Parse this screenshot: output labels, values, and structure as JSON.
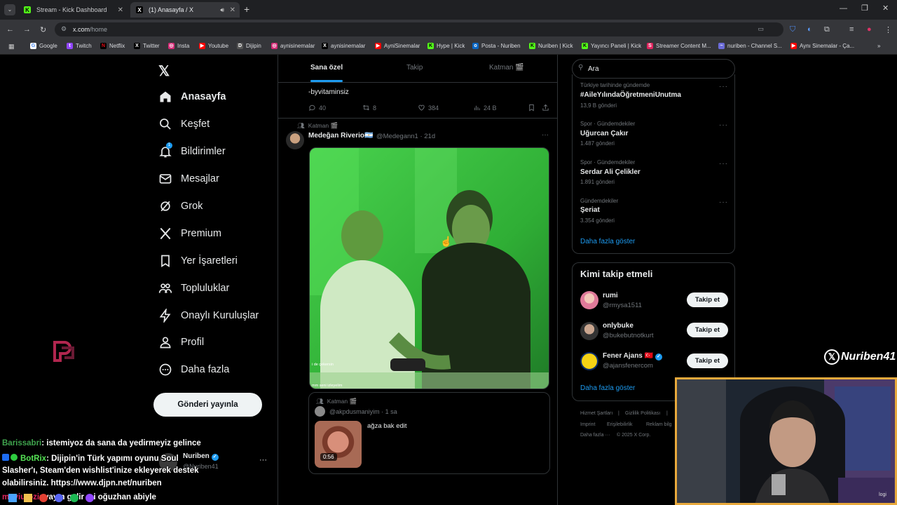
{
  "browser": {
    "tabs": [
      {
        "title": "Stream - Kick Dashboard",
        "active": false
      },
      {
        "title": "(1) Anasayfa / X",
        "active": true
      }
    ],
    "url_host": "x.com",
    "url_path": "/home",
    "bookmarks": [
      "Google",
      "Twitch",
      "Netflix",
      "Twitter",
      "Insta",
      "Youtube",
      "Dijipin",
      "aynisinemalar",
      "aynisinemalar",
      "AyniSinemalar",
      "Hype | Kick",
      "Posta - Nuriben",
      "Nuriben | Kick",
      "Yayıncı Paneli | Kick",
      "Streamer Content M...",
      "nuriben - Channel S...",
      "Aynı Sinemalar - Ça..."
    ]
  },
  "nav": {
    "items": [
      "Anasayfa",
      "Keşfet",
      "Bildirimler",
      "Mesajlar",
      "Grok",
      "Premium",
      "Yer İşaretleri",
      "Topluluklar",
      "Onaylı Kuruluşlar",
      "Profil",
      "Daha fazla"
    ],
    "notif_badge": "1",
    "post_button": "Gönderi yayınla",
    "account_name": "Nuriben",
    "account_handle": "@Nuriben41"
  },
  "timeline": {
    "tabs": [
      "Sana özel",
      "Takip",
      "Katman 🎬"
    ],
    "prev_tweet_text": "-byvitaminsiz",
    "prev_stats": {
      "replies": "40",
      "retweets": "8",
      "likes": "384",
      "views": "24 B"
    },
    "tweet": {
      "community": "Katman 🎬",
      "author": "Medeğan Riverio🇦🇷",
      "handle_time": "@Medegann1 · 21d",
      "video_caption_1": "i de çekersin",
      "video_caption_2": "mm seni izleyelim"
    },
    "quote": {
      "community": "Katman 🎬",
      "handle_time": "@akpdusmaniyim · 1 sa",
      "text": "ağza bak edit",
      "duration": "0:56"
    }
  },
  "sidebar": {
    "search_placeholder": "Ara",
    "trends": [
      {
        "meta": "Türkiye tarihinde gündemde",
        "name": "#AileYılındaÖğretmeniUnutma",
        "count": "13,9 B gönderi"
      },
      {
        "meta": "Spor · Gündemdekiler",
        "name": "Uğurcan Çakır",
        "count": "1.487 gönderi"
      },
      {
        "meta": "Spor · Gündemdekiler",
        "name": "Serdar Ali Çelikler",
        "count": "1.891 gönderi"
      },
      {
        "meta": "Gündemdekiler",
        "name": "Şeriat",
        "count": "3.354 gönderi"
      }
    ],
    "show_more": "Daha fazla göster",
    "who_title": "Kimi takip etmeli",
    "who": [
      {
        "name": "rumi",
        "handle": "@rmysa1511",
        "button": "Takip et"
      },
      {
        "name": "onlybuke",
        "handle": "@bukebutnotkurt",
        "button": "Takip et"
      },
      {
        "name": "Fener Ajans 🇹🇷",
        "handle": "@ajansfenercom",
        "button": "Takip et"
      }
    ],
    "who_more": "Daha fazla göster",
    "footer": [
      "Hizmet Şartları",
      "|",
      "Gizlilik Politikası",
      "|",
      "Imprint",
      "Erişilebilirlik",
      "Reklam bilg",
      "Daha fazla ···",
      "© 2025 X Corp."
    ]
  },
  "overlay": {
    "brand": "Nuriben41",
    "webcam_label": "logi",
    "chat": [
      {
        "user": "Barissabri",
        "user_color": "#3fa34d",
        "text": ": istemiyoz da sana da yedirmeyiz gelince"
      },
      {
        "user": "BotRix",
        "user_color": "#55e255",
        "text": ": Dijipin'in Türk yapımı oyunu Soul"
      },
      {
        "user": "",
        "user_color": "#ffffff",
        "text": "Slasher'ı, Steam'den wishlist'inize ekleyerek destek"
      },
      {
        "user": "",
        "user_color": "#ffffff",
        "text": "olabilirsiniz. https://www.djpn.net/nuriben"
      },
      {
        "user": "meviutozi",
        "user_color": "#e0245e",
        "text": ": yayın gelir mi oğuzhan abiyle"
      }
    ]
  },
  "colors": {
    "x_blue": "#1d9bf0",
    "green_screen": "#3fd14a",
    "kick_green": "#53fc18",
    "webcam_border": "#e8a93c"
  }
}
